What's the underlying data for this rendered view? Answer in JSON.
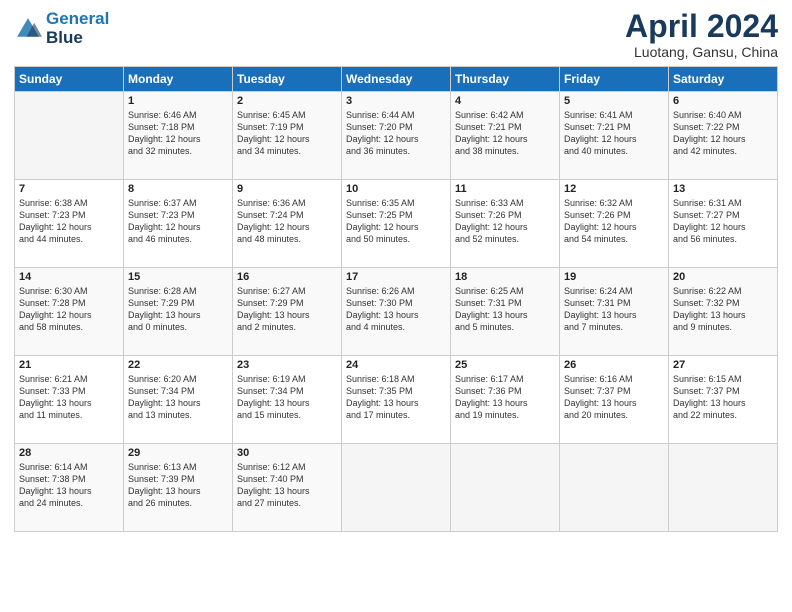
{
  "header": {
    "logo_line1": "General",
    "logo_line2": "Blue",
    "month": "April 2024",
    "location": "Luotang, Gansu, China"
  },
  "days_of_week": [
    "Sunday",
    "Monday",
    "Tuesday",
    "Wednesday",
    "Thursday",
    "Friday",
    "Saturday"
  ],
  "weeks": [
    [
      {
        "day": "",
        "sunrise": "",
        "sunset": "",
        "daylight": ""
      },
      {
        "day": "1",
        "sunrise": "Sunrise: 6:46 AM",
        "sunset": "Sunset: 7:18 PM",
        "daylight": "Daylight: 12 hours and 32 minutes."
      },
      {
        "day": "2",
        "sunrise": "Sunrise: 6:45 AM",
        "sunset": "Sunset: 7:19 PM",
        "daylight": "Daylight: 12 hours and 34 minutes."
      },
      {
        "day": "3",
        "sunrise": "Sunrise: 6:44 AM",
        "sunset": "Sunset: 7:20 PM",
        "daylight": "Daylight: 12 hours and 36 minutes."
      },
      {
        "day": "4",
        "sunrise": "Sunrise: 6:42 AM",
        "sunset": "Sunset: 7:21 PM",
        "daylight": "Daylight: 12 hours and 38 minutes."
      },
      {
        "day": "5",
        "sunrise": "Sunrise: 6:41 AM",
        "sunset": "Sunset: 7:21 PM",
        "daylight": "Daylight: 12 hours and 40 minutes."
      },
      {
        "day": "6",
        "sunrise": "Sunrise: 6:40 AM",
        "sunset": "Sunset: 7:22 PM",
        "daylight": "Daylight: 12 hours and 42 minutes."
      }
    ],
    [
      {
        "day": "7",
        "sunrise": "Sunrise: 6:38 AM",
        "sunset": "Sunset: 7:23 PM",
        "daylight": "Daylight: 12 hours and 44 minutes."
      },
      {
        "day": "8",
        "sunrise": "Sunrise: 6:37 AM",
        "sunset": "Sunset: 7:23 PM",
        "daylight": "Daylight: 12 hours and 46 minutes."
      },
      {
        "day": "9",
        "sunrise": "Sunrise: 6:36 AM",
        "sunset": "Sunset: 7:24 PM",
        "daylight": "Daylight: 12 hours and 48 minutes."
      },
      {
        "day": "10",
        "sunrise": "Sunrise: 6:35 AM",
        "sunset": "Sunset: 7:25 PM",
        "daylight": "Daylight: 12 hours and 50 minutes."
      },
      {
        "day": "11",
        "sunrise": "Sunrise: 6:33 AM",
        "sunset": "Sunset: 7:26 PM",
        "daylight": "Daylight: 12 hours and 52 minutes."
      },
      {
        "day": "12",
        "sunrise": "Sunrise: 6:32 AM",
        "sunset": "Sunset: 7:26 PM",
        "daylight": "Daylight: 12 hours and 54 minutes."
      },
      {
        "day": "13",
        "sunrise": "Sunrise: 6:31 AM",
        "sunset": "Sunset: 7:27 PM",
        "daylight": "Daylight: 12 hours and 56 minutes."
      }
    ],
    [
      {
        "day": "14",
        "sunrise": "Sunrise: 6:30 AM",
        "sunset": "Sunset: 7:28 PM",
        "daylight": "Daylight: 12 hours and 58 minutes."
      },
      {
        "day": "15",
        "sunrise": "Sunrise: 6:28 AM",
        "sunset": "Sunset: 7:29 PM",
        "daylight": "Daylight: 13 hours and 0 minutes."
      },
      {
        "day": "16",
        "sunrise": "Sunrise: 6:27 AM",
        "sunset": "Sunset: 7:29 PM",
        "daylight": "Daylight: 13 hours and 2 minutes."
      },
      {
        "day": "17",
        "sunrise": "Sunrise: 6:26 AM",
        "sunset": "Sunset: 7:30 PM",
        "daylight": "Daylight: 13 hours and 4 minutes."
      },
      {
        "day": "18",
        "sunrise": "Sunrise: 6:25 AM",
        "sunset": "Sunset: 7:31 PM",
        "daylight": "Daylight: 13 hours and 5 minutes."
      },
      {
        "day": "19",
        "sunrise": "Sunrise: 6:24 AM",
        "sunset": "Sunset: 7:31 PM",
        "daylight": "Daylight: 13 hours and 7 minutes."
      },
      {
        "day": "20",
        "sunrise": "Sunrise: 6:22 AM",
        "sunset": "Sunset: 7:32 PM",
        "daylight": "Daylight: 13 hours and 9 minutes."
      }
    ],
    [
      {
        "day": "21",
        "sunrise": "Sunrise: 6:21 AM",
        "sunset": "Sunset: 7:33 PM",
        "daylight": "Daylight: 13 hours and 11 minutes."
      },
      {
        "day": "22",
        "sunrise": "Sunrise: 6:20 AM",
        "sunset": "Sunset: 7:34 PM",
        "daylight": "Daylight: 13 hours and 13 minutes."
      },
      {
        "day": "23",
        "sunrise": "Sunrise: 6:19 AM",
        "sunset": "Sunset: 7:34 PM",
        "daylight": "Daylight: 13 hours and 15 minutes."
      },
      {
        "day": "24",
        "sunrise": "Sunrise: 6:18 AM",
        "sunset": "Sunset: 7:35 PM",
        "daylight": "Daylight: 13 hours and 17 minutes."
      },
      {
        "day": "25",
        "sunrise": "Sunrise: 6:17 AM",
        "sunset": "Sunset: 7:36 PM",
        "daylight": "Daylight: 13 hours and 19 minutes."
      },
      {
        "day": "26",
        "sunrise": "Sunrise: 6:16 AM",
        "sunset": "Sunset: 7:37 PM",
        "daylight": "Daylight: 13 hours and 20 minutes."
      },
      {
        "day": "27",
        "sunrise": "Sunrise: 6:15 AM",
        "sunset": "Sunset: 7:37 PM",
        "daylight": "Daylight: 13 hours and 22 minutes."
      }
    ],
    [
      {
        "day": "28",
        "sunrise": "Sunrise: 6:14 AM",
        "sunset": "Sunset: 7:38 PM",
        "daylight": "Daylight: 13 hours and 24 minutes."
      },
      {
        "day": "29",
        "sunrise": "Sunrise: 6:13 AM",
        "sunset": "Sunset: 7:39 PM",
        "daylight": "Daylight: 13 hours and 26 minutes."
      },
      {
        "day": "30",
        "sunrise": "Sunrise: 6:12 AM",
        "sunset": "Sunset: 7:40 PM",
        "daylight": "Daylight: 13 hours and 27 minutes."
      },
      {
        "day": "",
        "sunrise": "",
        "sunset": "",
        "daylight": ""
      },
      {
        "day": "",
        "sunrise": "",
        "sunset": "",
        "daylight": ""
      },
      {
        "day": "",
        "sunrise": "",
        "sunset": "",
        "daylight": ""
      },
      {
        "day": "",
        "sunrise": "",
        "sunset": "",
        "daylight": ""
      }
    ]
  ]
}
